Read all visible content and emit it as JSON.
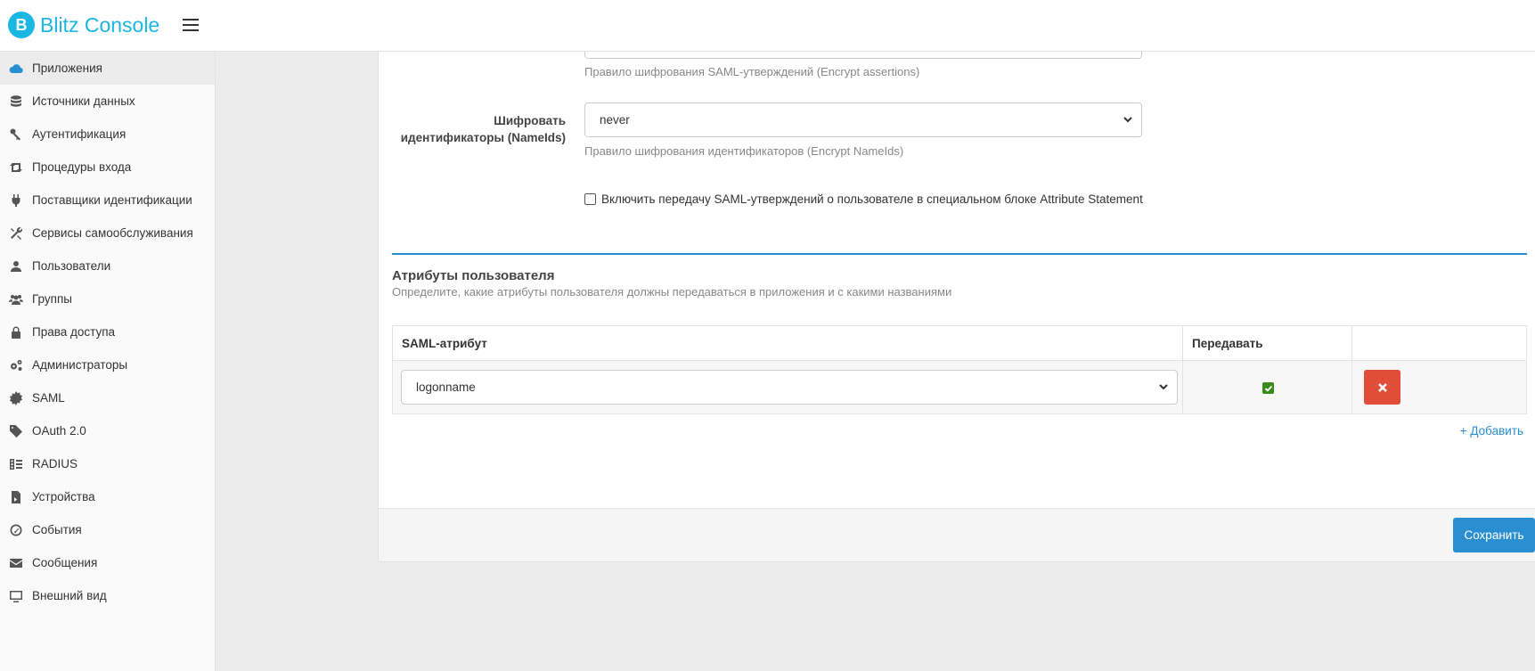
{
  "app": {
    "title": "Blitz Console",
    "logo_letter": "B"
  },
  "sidebar": {
    "items": [
      {
        "label": "Приложения",
        "icon": "cloud-icon"
      },
      {
        "label": "Источники данных",
        "icon": "database-icon"
      },
      {
        "label": "Аутентификация",
        "icon": "keys-icon"
      },
      {
        "label": "Процедуры входа",
        "icon": "retweet-icon"
      },
      {
        "label": "Поставщики идентификации",
        "icon": "plug-icon"
      },
      {
        "label": "Сервисы самообслуживания",
        "icon": "wrench-icon"
      },
      {
        "label": "Пользователи",
        "icon": "user-icon"
      },
      {
        "label": "Группы",
        "icon": "users-icon"
      },
      {
        "label": "Права доступа",
        "icon": "lock-icon"
      },
      {
        "label": "Администраторы",
        "icon": "cogs-icon"
      },
      {
        "label": "SAML",
        "icon": "certificate-icon"
      },
      {
        "label": "OAuth 2.0",
        "icon": "tag-icon"
      },
      {
        "label": "RADIUS",
        "icon": "server-icon"
      },
      {
        "label": "Устройства",
        "icon": "device-icon"
      },
      {
        "label": "События",
        "icon": "dashboard-icon"
      },
      {
        "label": "Сообщения",
        "icon": "envelope-icon"
      },
      {
        "label": "Внешний вид",
        "icon": "monitor-icon"
      }
    ]
  },
  "form": {
    "encrypt_assertions_help": "Правило шифрования SAML-утверждений (Encrypt assertions)",
    "encrypt_nameids_label_line1": "Шифровать",
    "encrypt_nameids_label_line2": "идентификаторы (NameIds)",
    "encrypt_nameids_value": "never",
    "encrypt_nameids_help": "Правило шифрования идентификаторов (Encrypt NameIds)",
    "attribute_statement_label": "Включить передачу SAML-утверждений о пользователе в специальном блоке Attribute Statement",
    "attribute_statement_checked": false
  },
  "attributes": {
    "title": "Атрибуты пользователя",
    "description": "Определите, какие атрибуты пользователя должны передаваться в приложения и с какими названиями",
    "columns": {
      "saml_attribute": "SAML-атрибут",
      "transmit": "Передавать"
    },
    "rows": [
      {
        "attribute": "logonname",
        "transmit": true
      }
    ],
    "add_label": "+ Добавить"
  },
  "footer": {
    "save_label": "Сохранить"
  },
  "colors": {
    "accent": "#2a8fd0",
    "brand": "#1ab7e2",
    "danger": "#e04e39",
    "success": "#3a8a1c"
  }
}
